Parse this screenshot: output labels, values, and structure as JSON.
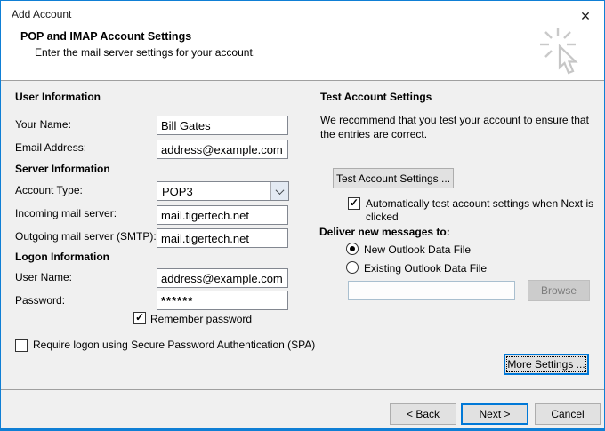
{
  "window": {
    "title": "Add Account"
  },
  "icons": {
    "close": "✕",
    "check": "✓"
  },
  "header": {
    "title": "POP and IMAP Account Settings",
    "subtitle": "Enter the mail server settings for your account."
  },
  "user_info": {
    "heading": "User Information",
    "name_label": "Your Name:",
    "name_value": "Bill Gates",
    "email_label": "Email Address:",
    "email_value": "address@example.com"
  },
  "server_info": {
    "heading": "Server Information",
    "account_type_label": "Account Type:",
    "account_type_value": "POP3",
    "incoming_label": "Incoming mail server:",
    "incoming_value": "mail.tigertech.net",
    "outgoing_label": "Outgoing mail server (SMTP):",
    "outgoing_value": "mail.tigertech.net"
  },
  "logon_info": {
    "heading": "Logon Information",
    "user_label": "User Name:",
    "user_value": "address@example.com",
    "password_label": "Password:",
    "password_value": "******",
    "remember_label": "Remember password"
  },
  "spa": {
    "label": "Require logon using Secure Password Authentication (SPA)"
  },
  "test": {
    "heading": "Test Account Settings",
    "description": "We recommend that you test your account to ensure that the entries are correct.",
    "button_label": "Test Account Settings ...",
    "auto_test_label": "Automatically test account settings when Next is clicked"
  },
  "deliver": {
    "heading": "Deliver new messages to:",
    "option_new": "New Outlook Data File",
    "option_existing": "Existing Outlook Data File",
    "path_value": "",
    "browse_label": "Browse"
  },
  "more_settings_label": "More Settings ...",
  "footer": {
    "back_label": "< Back",
    "next_label": "Next >",
    "cancel_label": "Cancel"
  },
  "colors": {
    "accent": "#0078d7",
    "body_bg": "#f0f0f0",
    "header_bg": "#ffffff",
    "separator": "#9f9f9f"
  }
}
